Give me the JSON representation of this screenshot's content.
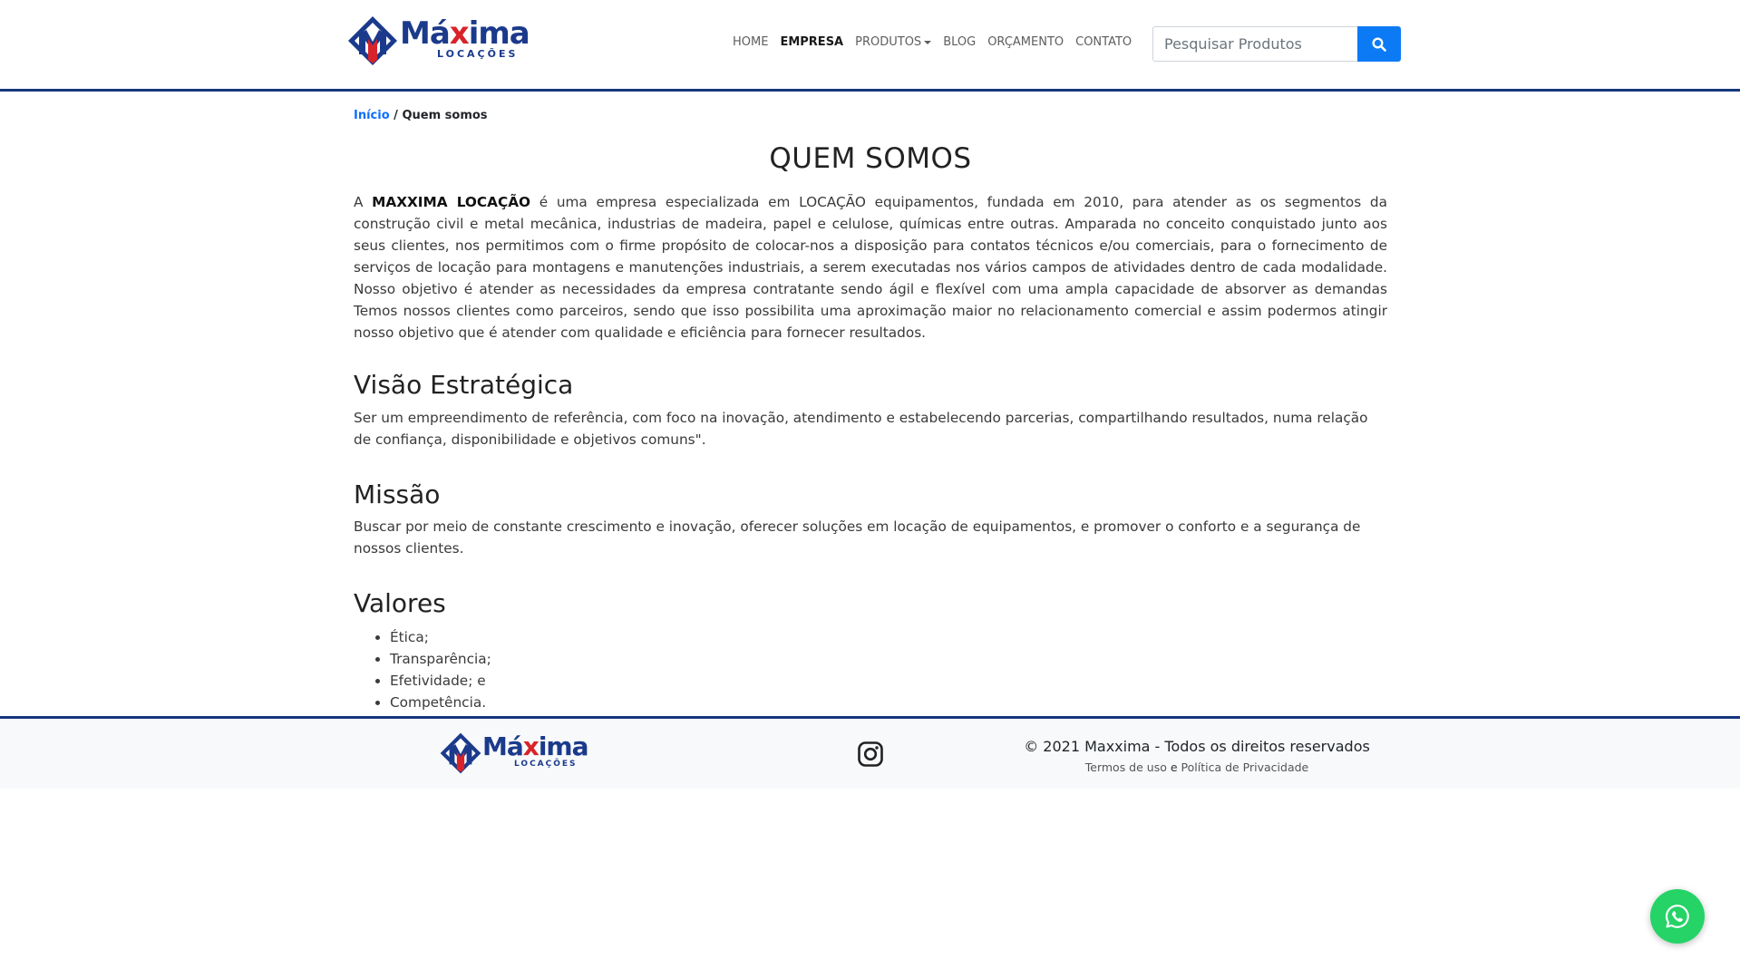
{
  "header": {
    "logo": {
      "brand": "Máxima",
      "subtitle": "LOCAÇÕES"
    },
    "nav": {
      "home": "HOME",
      "empresa": "EMPRESA",
      "produtos": "PRODUTOS",
      "blog": "BLOG",
      "orcamento": "ORÇAMENTO",
      "contato": "CONTATO"
    },
    "active_nav": "EMPRESA",
    "search": {
      "placeholder": "Pesquisar Produtos",
      "value": "",
      "icon": "search-icon"
    }
  },
  "breadcrumb": {
    "home": "Início",
    "separator": " / ",
    "current": "Quem somos"
  },
  "page": {
    "title": "QUEM SOMOS",
    "intro": {
      "prefix": "A ",
      "company": "MAXXIMA LOCAÇÃO",
      "text": " é uma empresa especializada em LOCAÇÃO equipamentos, fundada em 2010, para atender as os segmentos da construção civil e metal mecânica, industrias de madeira, papel e celulose, químicas entre outras. Amparada no conceito conquistado junto aos seus clientes, nos permitimos com o firme propósito de colocar-nos a disposição para contatos técnicos e/ou comerciais, para o fornecimento de serviços de locação para montagens e manutenções industriais, a serem executadas nos vários campos de atividades dentro de cada modalidade. Nosso objetivo é atender as necessidades da empresa contratante sendo ágil e flexível com uma ampla capacidade de absorver as demandas Temos nossos clientes como parceiros, sendo que isso possibilita uma aproximação maior no relacionamento comercial e assim podermos atingir nosso objetivo que é atender com qualidade e eficiência para fornecer resultados."
    },
    "vision": {
      "heading": "Visão Estratégica",
      "text": "Ser um empreendimento de referência, com foco na inovação, atendimento e estabelecendo parcerias, compartilhando resultados, numa relação de confiança, disponibilidade e objetivos comuns\"."
    },
    "mission": {
      "heading": "Missão",
      "text": "Buscar por meio de constante crescimento e inovação, oferecer soluções em locação de equipamentos, e promover o conforto e a segurança de nossos clientes."
    },
    "values": {
      "heading": "Valores",
      "items": [
        "Ética;",
        "Transparência;",
        "Efetividade; e",
        "Competência."
      ]
    }
  },
  "footer": {
    "logo": {
      "brand": "Máxima",
      "subtitle": "LOCAÇÕES"
    },
    "social_icon": "instagram-icon",
    "copyright": "© 2021 Maxxima - Todos os direitos reservados",
    "terms": "Termos de uso",
    "conjunction": " e ",
    "privacy": "Política de Privacidade"
  },
  "whatsapp_icon": "whatsapp-icon",
  "colors": {
    "brand_blue": "#1b3a8c",
    "brand_red": "#d8232a",
    "header_border": "#16367d",
    "search_button": "#0d7af5",
    "link": "#0d6efd",
    "whatsapp": "#25d366"
  }
}
